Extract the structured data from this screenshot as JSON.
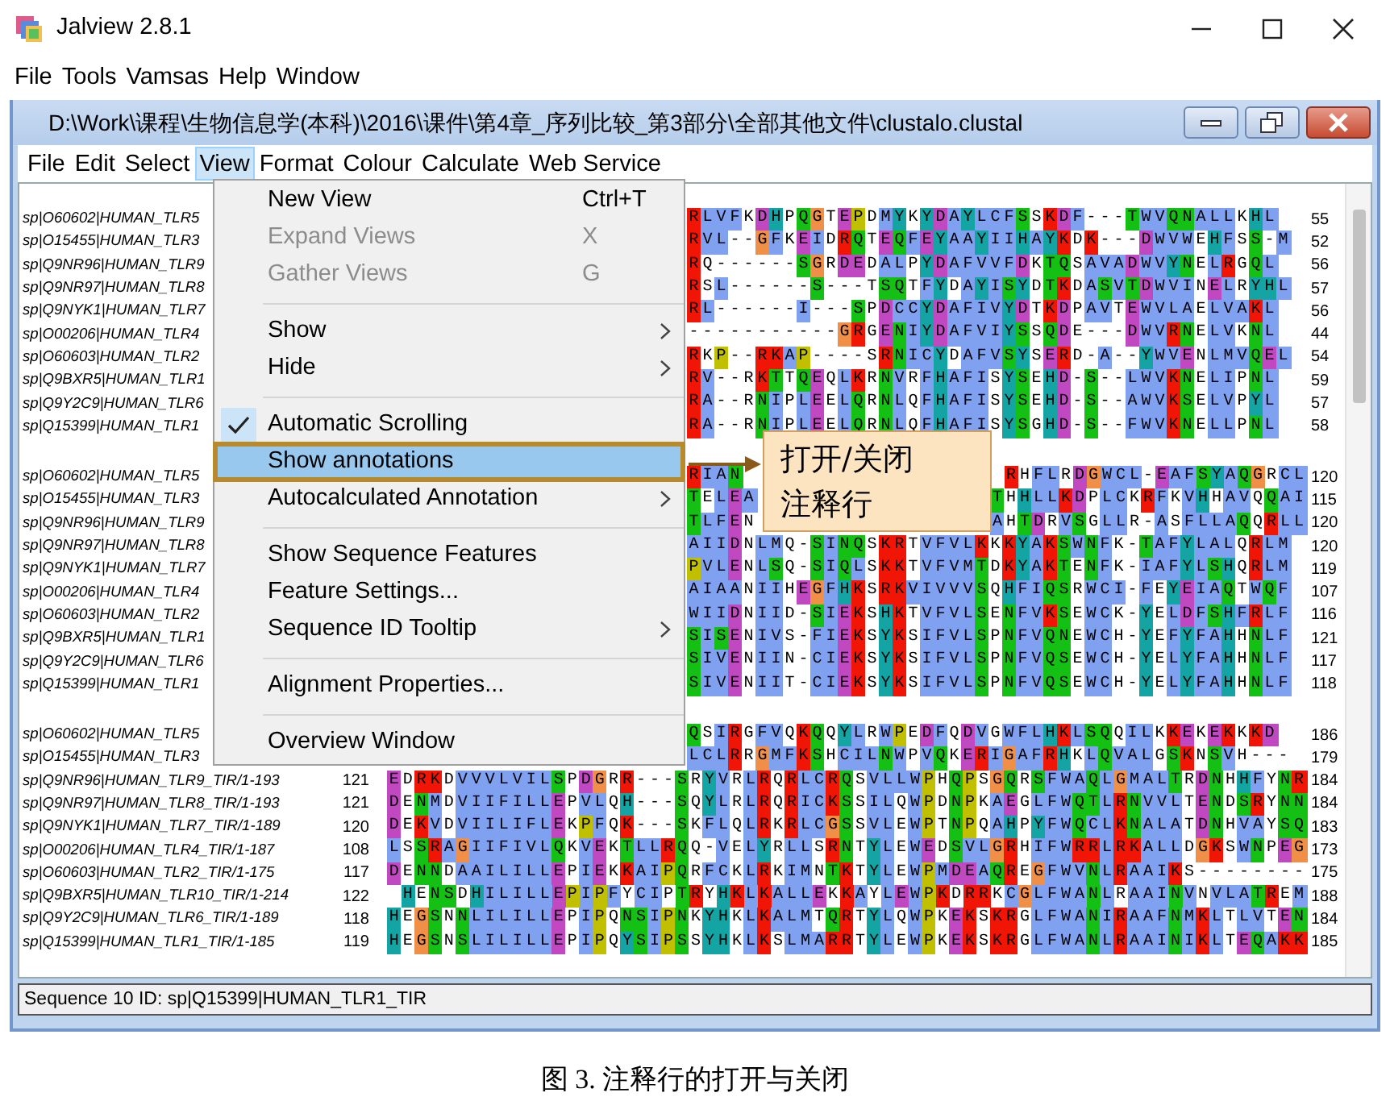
{
  "app": {
    "title": "Jalview 2.8.1",
    "menu": [
      {
        "label": "File"
      },
      {
        "label": "Tools"
      },
      {
        "label": "Vamsas"
      },
      {
        "label": "Help"
      },
      {
        "label": "Window"
      }
    ]
  },
  "document": {
    "title": "D:\\Work\\课程\\生物信息学(本科)\\2016\\课件\\第4章_序列比较_第3部分\\全部其他文件\\clustalo.clustal",
    "menu": [
      {
        "label": "File",
        "selected": false
      },
      {
        "label": "Edit",
        "selected": false
      },
      {
        "label": "Select",
        "selected": false
      },
      {
        "label": "View",
        "selected": true
      },
      {
        "label": "Format",
        "selected": false
      },
      {
        "label": "Colour",
        "selected": false
      },
      {
        "label": "Calculate",
        "selected": false
      },
      {
        "label": "Web Service",
        "selected": false
      }
    ]
  },
  "view_menu": {
    "items": [
      {
        "kind": "item",
        "label": "New View",
        "shortcut": "Ctrl+T",
        "disabled": false,
        "checked": false,
        "selected": false,
        "submenu": false
      },
      {
        "kind": "item",
        "label": "Expand Views",
        "shortcut": "X",
        "disabled": true,
        "checked": false,
        "selected": false,
        "submenu": false
      },
      {
        "kind": "item",
        "label": "Gather Views",
        "shortcut": "G",
        "disabled": true,
        "checked": false,
        "selected": false,
        "submenu": false
      },
      {
        "kind": "separator"
      },
      {
        "kind": "item",
        "label": "Show",
        "disabled": false,
        "checked": false,
        "selected": false,
        "submenu": true
      },
      {
        "kind": "item",
        "label": "Hide",
        "disabled": false,
        "checked": false,
        "selected": false,
        "submenu": true
      },
      {
        "kind": "separator"
      },
      {
        "kind": "item",
        "label": "Automatic Scrolling",
        "disabled": false,
        "checked": true,
        "selected": false,
        "submenu": false
      },
      {
        "kind": "item",
        "label": "Show annotations",
        "disabled": false,
        "checked": false,
        "selected": true,
        "submenu": false
      },
      {
        "kind": "item",
        "label": "Autocalculated Annotation",
        "disabled": false,
        "checked": false,
        "selected": false,
        "submenu": true
      },
      {
        "kind": "separator"
      },
      {
        "kind": "item",
        "label": "Show Sequence Features",
        "disabled": false,
        "checked": false,
        "selected": false,
        "submenu": false
      },
      {
        "kind": "item",
        "label": "Feature Settings...",
        "disabled": false,
        "checked": false,
        "selected": false,
        "submenu": false
      },
      {
        "kind": "item",
        "label": "Sequence ID Tooltip",
        "disabled": false,
        "checked": false,
        "selected": false,
        "submenu": true
      },
      {
        "kind": "separator"
      },
      {
        "kind": "item",
        "label": "Alignment Properties...",
        "disabled": false,
        "checked": false,
        "selected": false,
        "submenu": false
      },
      {
        "kind": "separator"
      },
      {
        "kind": "item",
        "label": "Overview Window",
        "disabled": false,
        "checked": false,
        "selected": false,
        "submenu": false
      }
    ]
  },
  "callout": {
    "lines": [
      "打开/关闭",
      "注释行"
    ]
  },
  "alignment": {
    "blocks": [
      {
        "rows": [
          {
            "id": "sp|O60602|HUMAN_TLR5",
            "sequence": "RLVFKDHPQGTEPDMYKYDAYLCFSSKDF---TWVQNALLKHL",
            "end": "55"
          },
          {
            "id": "sp|O15455|HUMAN_TLR3",
            "sequence": "RVL--GFKEIDRQTEQFEYAAYIIHAYKDK---DWVWEHFSS-M",
            "end": "52"
          },
          {
            "id": "sp|Q9NR96|HUMAN_TLR9",
            "sequence": "RQ------SGRDEDALPYDAFVVFDKTQSAVADWVYNELRGQL",
            "end": "56"
          },
          {
            "id": "sp|Q9NR97|HUMAN_TLR8",
            "sequence": "RSL------S---TSQTFYDAYISYDTKDASVTDWVINELRYHL",
            "end": "57"
          },
          {
            "id": "sp|Q9NYK1|HUMAN_TLR7",
            "sequence": "RL------I---SPDCCYDAFIVYDTKDPAVTEWVLAELVAKL",
            "end": "56"
          },
          {
            "id": "sp|O00206|HUMAN_TLR4",
            "sequence": "-----------GRGENIYDAFVIYSSQDE---DWVRNELVKNL",
            "end": "44"
          },
          {
            "id": "sp|O60603|HUMAN_TLR2",
            "sequence": "RKP--RKAP----SRNICYDAFVSYSERD-A--YWVENLMVQEL",
            "end": "54"
          },
          {
            "id": "sp|Q9BXR5|HUMAN_TLR1",
            "sequence": "RV--RKTTQEQLKRNVRFHAFISYSEHD-S--LWVKNELIPNL",
            "end": "59"
          },
          {
            "id": "sp|Q9Y2C9|HUMAN_TLR6",
            "sequence": "RA--RNIPLEELQRNLQFHAFISYSEHD-S--AWVKSELVPYL",
            "end": "57"
          },
          {
            "id": "sp|Q15399|HUMAN_TLR1",
            "sequence": "RA--RNIPLEELQRNLQFHAFISYSGHD-S--FWVKNELLPNL",
            "end": "58"
          }
        ]
      },
      {
        "rows": [
          {
            "id": "sp|O60602|HUMAN_TLR5",
            "sequence": "RIAN",
            "sequence_right": "RHFLRDGWCL-EAFSYAQGRCL",
            "end": "120"
          },
          {
            "id": "sp|O15455|HUMAN_TLR3",
            "sequence": "TELEA",
            "sequence_right": "THHLLKDPLCKRFKVHHAVQQAI",
            "end": "115"
          },
          {
            "id": "sp|Q9NR96|HUMAN_TLR9",
            "sequence": "TLFEN",
            "sequence_right": "AHTDRVSGLLR-ASFLLAQQRLL",
            "end": "120"
          },
          {
            "id": "sp|Q9NR97|HUMAN_TLR8",
            "sequence": "AIIDNLMQ-SINQSKRTVFVLKKKYAKSWNFK-TAFYLALQRLM",
            "end": "120"
          },
          {
            "id": "sp|Q9NYK1|HUMAN_TLR7",
            "sequence": "PVLENLSQ-SIQLSKKTVFVMTDKYAKTENFK-IAFYLSHQRLM",
            "end": "119"
          },
          {
            "id": "sp|O00206|HUMAN_TLR4",
            "sequence": "AIAANIIHEGFHKSRKVIVVVSQHFIQSRWCI-FEYEIAQTWQF",
            "end": "107"
          },
          {
            "id": "sp|O60603|HUMAN_TLR2",
            "sequence": "WIIDNIID-SIEKSHKTVFVLSENFVKSEWCK-YELDFSHFRLF",
            "end": "116"
          },
          {
            "id": "sp|Q9BXR5|HUMAN_TLR1",
            "sequence": "SISENIVS-FIEKSYKSIFVLSPNFVQNEWCH-YEFYFAHHNLF",
            "end": "121"
          },
          {
            "id": "sp|Q9Y2C9|HUMAN_TLR6",
            "sequence": "SIVENIIN-CIEKSYKSIFVLSPNFVQSEWCH-YELYFAHHNLF",
            "end": "117"
          },
          {
            "id": "sp|Q15399|HUMAN_TLR1",
            "sequence": "SIVENIIT-CIEKSYKSIFVLSPNFVQSEWCH-YELYFAHHNLF",
            "end": "118"
          }
        ]
      },
      {
        "rows": [
          {
            "id": "sp|O60602|HUMAN_TLR5",
            "sequence": "QSIRGFVQKQQYLRWPEDFQDVGWFLHKLSQQILKKEKEKKKD",
            "end": "186"
          },
          {
            "id": "sp|O15455|HUMAN_TLR3",
            "sequence": "LCLRRGMFKSHCILNWPVQKERIGAFRHKLQVALGSKNSVH---",
            "end": "179"
          },
          {
            "id": "sp|Q9NR96|HUMAN_TLR9_TIR/1-193",
            "start": "121",
            "sequence": "EDRKDVVVLVILSPDGRR---SRYVRLRQRLCRQSVLLWPHQPSGQRSFWAQLGMALTRDNHHFYNR",
            "end": "184"
          },
          {
            "id": "sp|Q9NR97|HUMAN_TLR8_TIR/1-193",
            "start": "121",
            "sequence": "DENMDVIIFILLEPVLQH---SQYLRLRQRICKSSILQWPDNPKAEGLFWQTLRNVVLTENDSRYNN",
            "end": "184"
          },
          {
            "id": "sp|Q9NYK1|HUMAN_TLR7_TIR/1-189",
            "start": "120",
            "sequence": "DEKVDVIILIFLEKPFQK---SKFLQLRKRLCGSSVLEWPTNPQAHPYFWQCLKNALATDNHVAYSQ",
            "end": "183"
          },
          {
            "id": "sp|O00206|HUMAN_TLR4_TIR/1-187",
            "start": "108",
            "sequence": "LSSRAGIIFIVLQKVEKTLLRQQ-VELYRLLSRNTYLEWEDSVLGRHIFWRRLRKALLDGKSWNPEG",
            "end": "173"
          },
          {
            "id": "sp|O60603|HUMAN_TLR2_TIR/1-175",
            "start": "117",
            "sequence": "DENNDAAILILLEPIEKKAIPQRFCKLRKIMNTKTYLEWPMDEAQREGFWVNLRAAIKS--------",
            "end": "175"
          },
          {
            "id": "sp|Q9BXR5|HUMAN_TLR10_TIR/1-214",
            "start": "122",
            "sequence": "HENSDHILILLEPIPFYCIPTRYHKLKALLEKKAYLEWPKDRRKCGLFWANLRAAINVNVLATREM",
            "end": "188"
          },
          {
            "id": "sp|Q9Y2C9|HUMAN_TLR6_TIR/1-189",
            "start": "118",
            "sequence": "HEGSNNLILILLEPIPQNSIPNKYHKLKALMTQRTYLQWPKEKSKRGLFWANIRAAFNMKLTLVTEN",
            "end": "184"
          },
          {
            "id": "sp|Q15399|HUMAN_TLR1_TIR/1-185",
            "start": "119",
            "sequence": "HEGSNSLILILLEPIPQYSIPSSYHKLKSLMARRTYLEWPKEKSKRGLFWANLRAAINIKLTEQAKK",
            "end": "185"
          }
        ]
      }
    ]
  },
  "status_bar": "Sequence 10 ID: sp|Q15399|HUMAN_TLR1_TIR",
  "caption": "图 3. 注释行的打开与关闭"
}
